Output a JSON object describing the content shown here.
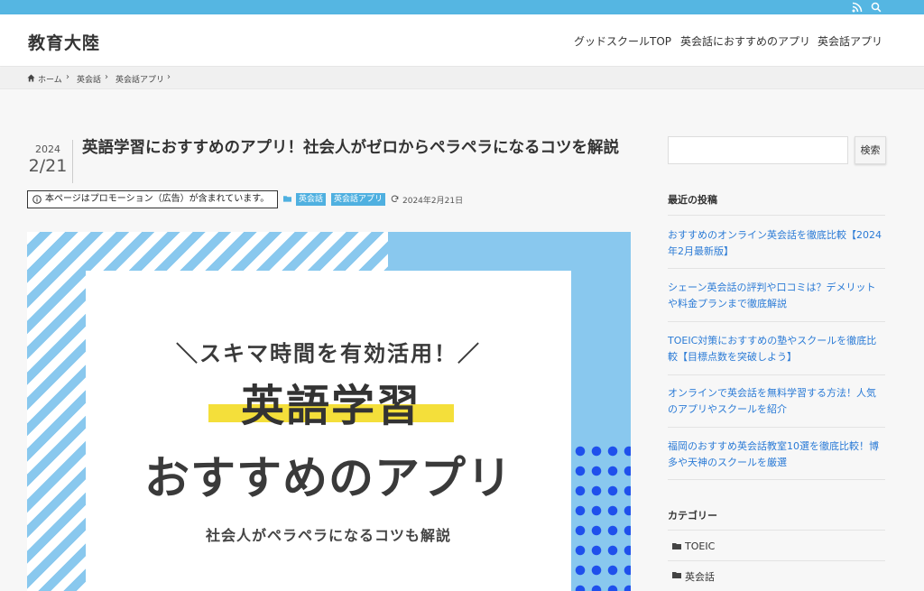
{
  "topbar": {
    "rss_icon": "rss-icon",
    "search_icon": "search-icon",
    "color": "#55b6e2"
  },
  "header": {
    "site_title": "教育大陸",
    "nav": [
      "グッドスクールTOP",
      "英会話におすすめのアプリ",
      "英会話アプリ"
    ]
  },
  "breadcrumb": {
    "home": "ホーム",
    "items": [
      "英会話",
      "英会話アプリ"
    ]
  },
  "post": {
    "date_year": "2024",
    "date_md": "2/21",
    "title": "英語学習におすすめのアプリ！社会人がゼロからペラペラになるコツを解説",
    "promo": "本ページはプロモーション（広告）が含まれています。",
    "categories": [
      "英会話",
      "英会話アプリ"
    ],
    "updated": "2024年2月21日"
  },
  "eyecatch": {
    "line1": "＼スキマ時間を有効活用！／",
    "line2": "英語学習",
    "line3": "おすすめのアプリ",
    "line4": "社会人がペラペラになるコツも解説"
  },
  "sidebar": {
    "search_placeholder": "",
    "search_button": "検索",
    "recent_title": "最近の投稿",
    "recent_posts": [
      "おすすめのオンライン英会話を徹底比較【2024年2月最新版】",
      "シェーン英会話の評判や口コミは？デメリットや料金プランまで徹底解説",
      "TOEIC対策におすすめの塾やスクールを徹底比較【目標点数を突破しよう】",
      "オンラインで英会話を無料学習する方法！人気のアプリやスクールを紹介",
      "福岡のおすすめ英会話教室10選を徹底比較！博多や天神のスクールを厳選"
    ],
    "categories_title": "カテゴリー",
    "categories": [
      "TOEIC",
      "英会話"
    ]
  },
  "colors": {
    "accent": "#4fb0e0",
    "link": "#2b7bd6",
    "highlight": "#f4df3a",
    "dots": "#1f50ec"
  }
}
